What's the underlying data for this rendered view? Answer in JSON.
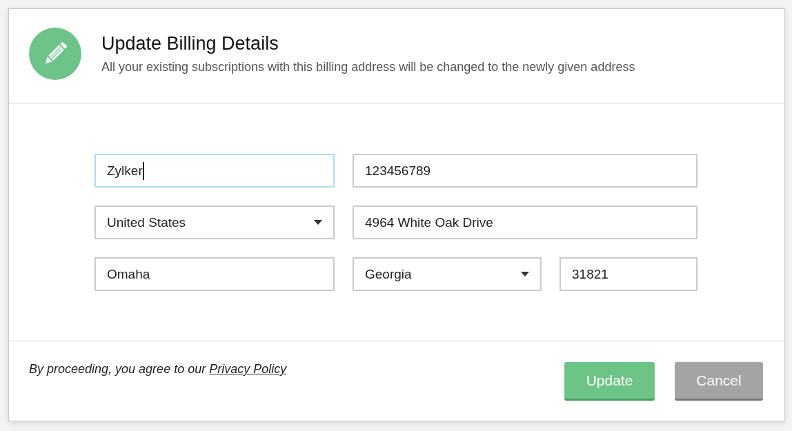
{
  "dialog": {
    "title": "Update Billing Details",
    "subtitle": "All your existing subscriptions with this billing address will be changed to the newly given address"
  },
  "form_rows": [
    {
      "fields": [
        {
          "kind": "text",
          "value": "Zylker",
          "focused": true
        },
        {
          "kind": "text",
          "value": "123456789",
          "focused": false
        }
      ]
    },
    {
      "fields": [
        {
          "kind": "dropdown",
          "value": "United States",
          "focused": false
        },
        {
          "kind": "text",
          "value": "4964 White Oak Drive",
          "focused": false
        }
      ]
    },
    {
      "fields": [
        {
          "kind": "text",
          "value": "Omaha",
          "focused": false
        },
        {
          "kind": "dropdown",
          "value": "Georgia",
          "focused": false
        },
        {
          "kind": "text",
          "value": "31821",
          "focused": false
        }
      ]
    }
  ],
  "footer": {
    "notice": "By proceeding, you agree to our",
    "link": "Privacy Policy"
  },
  "buttons": [
    {
      "label": "Update",
      "kind": "primary"
    },
    {
      "label": "Cancel",
      "kind": "secondary"
    }
  ]
}
